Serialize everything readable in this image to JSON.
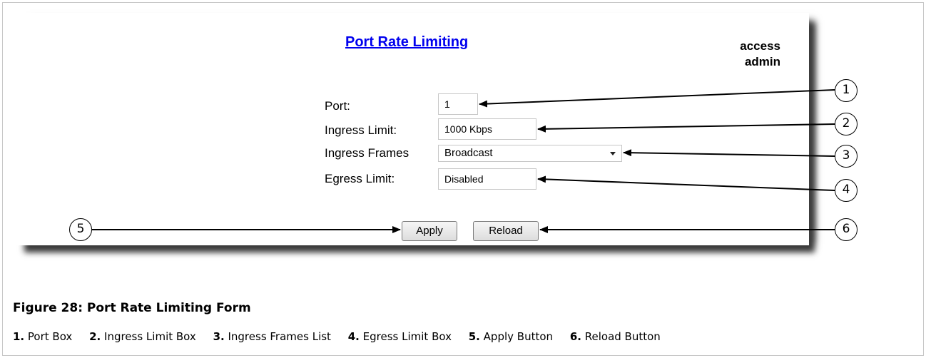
{
  "panel": {
    "title": "Port Rate Limiting",
    "access_label": "access",
    "user": "admin"
  },
  "form": {
    "port_label": "Port:",
    "port_value": "1",
    "ingress_limit_label": "Ingress Limit:",
    "ingress_limit_value": "1000 Kbps",
    "ingress_frames_label": "Ingress Frames",
    "ingress_frames_value": "Broadcast",
    "egress_limit_label": "Egress Limit:",
    "egress_limit_value": "Disabled",
    "apply_label": "Apply",
    "reload_label": "Reload"
  },
  "callouts": [
    "1",
    "2",
    "3",
    "4",
    "5",
    "6"
  ],
  "figure": {
    "title": "Figure 28: Port Rate Limiting Form",
    "legend": [
      {
        "num": "1.",
        "text": "Port Box"
      },
      {
        "num": "2.",
        "text": "Ingress Limit Box"
      },
      {
        "num": "3.",
        "text": "Ingress Frames List"
      },
      {
        "num": "4.",
        "text": "Egress Limit Box"
      },
      {
        "num": "5.",
        "text": "Apply Button"
      },
      {
        "num": "6.",
        "text": "Reload Button"
      }
    ]
  }
}
